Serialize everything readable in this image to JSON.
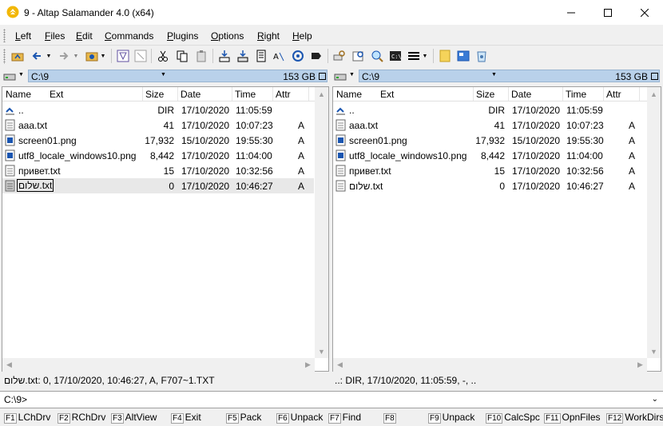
{
  "window": {
    "title": "9 - Altap Salamander 4.0 (x64)"
  },
  "menu": [
    {
      "label": "Left",
      "u": "L",
      "rest": "eft"
    },
    {
      "label": "Files",
      "u": "F",
      "rest": "iles"
    },
    {
      "label": "Edit",
      "u": "E",
      "rest": "dit"
    },
    {
      "label": "Commands",
      "u": "C",
      "rest": "ommands"
    },
    {
      "label": "Plugins",
      "u": "P",
      "rest": "lugins"
    },
    {
      "label": "Options",
      "u": "O",
      "rest": "ptions"
    },
    {
      "label": "Right",
      "u": "R",
      "rest": "ight"
    },
    {
      "label": "Help",
      "u": "H",
      "rest": "elp"
    }
  ],
  "columns": {
    "name": "Name",
    "ext": "Ext",
    "size": "Size",
    "date": "Date",
    "time": "Time",
    "attr": "Attr"
  },
  "left": {
    "path": "C:\\9",
    "free": "153 GB",
    "files": [
      {
        "name": "..",
        "size": "DIR",
        "date": "17/10/2020",
        "time": "11:05:59",
        "attr": ""
      },
      {
        "name": "aaa.txt",
        "size": "41",
        "date": "17/10/2020",
        "time": "10:07:23",
        "attr": "A"
      },
      {
        "name": "screen01.png",
        "size": "17,932",
        "date": "15/10/2020",
        "time": "19:55:30",
        "attr": "A"
      },
      {
        "name": "utf8_locale_windows10.png",
        "size": "8,442",
        "date": "17/10/2020",
        "time": "11:04:00",
        "attr": "A"
      },
      {
        "name": "привет.txt",
        "size": "15",
        "date": "17/10/2020",
        "time": "10:32:56",
        "attr": "A"
      },
      {
        "name": "שלום.txt",
        "size": "0",
        "date": "17/10/2020",
        "time": "10:46:27",
        "attr": "A"
      }
    ],
    "status": "שלום.txt: 0, 17/10/2020, 10:46:27, A, F707~1.TXT"
  },
  "right": {
    "path": "C:\\9",
    "free": "153 GB",
    "files": [
      {
        "name": "..",
        "size": "DIR",
        "date": "17/10/2020",
        "time": "11:05:59",
        "attr": ""
      },
      {
        "name": "aaa.txt",
        "size": "41",
        "date": "17/10/2020",
        "time": "10:07:23",
        "attr": "A"
      },
      {
        "name": "screen01.png",
        "size": "17,932",
        "date": "15/10/2020",
        "time": "19:55:30",
        "attr": "A"
      },
      {
        "name": "utf8_locale_windows10.png",
        "size": "8,442",
        "date": "17/10/2020",
        "time": "11:04:00",
        "attr": "A"
      },
      {
        "name": "привет.txt",
        "size": "15",
        "date": "17/10/2020",
        "time": "10:32:56",
        "attr": "A"
      },
      {
        "name": "שלום.txt",
        "size": "0",
        "date": "17/10/2020",
        "time": "10:46:27",
        "attr": "A"
      }
    ],
    "status": "..: DIR, 17/10/2020, 11:05:59, -, .."
  },
  "cmdline": {
    "prompt": "C:\\9>"
  },
  "fkeys": [
    {
      "key": "F1",
      "label": "LChDrv"
    },
    {
      "key": "F2",
      "label": "RChDrv"
    },
    {
      "key": "F3",
      "label": "AltView"
    },
    {
      "key": "F4",
      "label": "Exit"
    },
    {
      "key": "F5",
      "label": "Pack"
    },
    {
      "key": "F6",
      "label": "Unpack"
    },
    {
      "key": "F7",
      "label": "Find"
    },
    {
      "key": "F8",
      "label": ""
    },
    {
      "key": "F9",
      "label": "Unpack"
    },
    {
      "key": "F10",
      "label": "CalcSpc"
    },
    {
      "key": "F11",
      "label": "OpnFiles"
    },
    {
      "key": "F12",
      "label": "WorkDirs"
    }
  ]
}
